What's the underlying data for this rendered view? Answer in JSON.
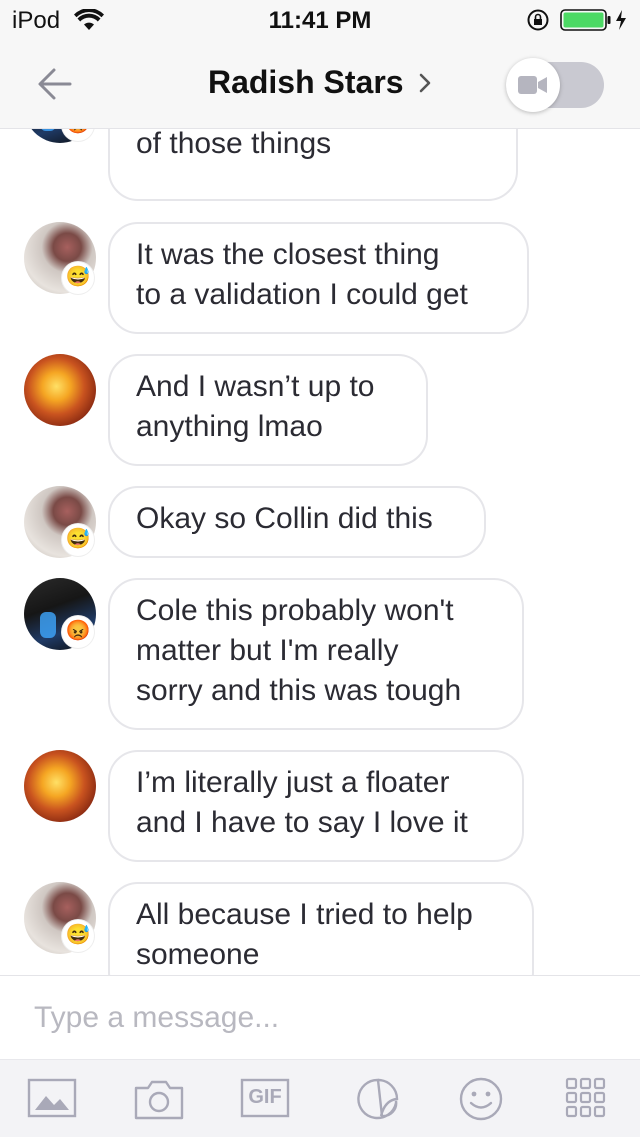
{
  "status_bar": {
    "carrier": "iPod",
    "time": "11:41 PM"
  },
  "header": {
    "title": "Radish Stars"
  },
  "messages": [
    {
      "text": "Umm and I didn't do any\nof those things",
      "emoji": "😡"
    },
    {
      "text": "It was the closest thing\nto a validation I could get",
      "emoji": "😅"
    },
    {
      "text": "And I wasn’t up to\nanything lmao",
      "emoji": ""
    },
    {
      "text": "Okay so Collin did this",
      "emoji": "😅"
    },
    {
      "text": "Cole this probably won't\nmatter but I'm really\nsorry and this was tough",
      "emoji": "😡"
    },
    {
      "text": "I’m literally just a floater\nand I have to say I love it",
      "emoji": ""
    },
    {
      "text": "All because I tried to help\nsomeone",
      "emoji": "😅"
    }
  ],
  "composer": {
    "placeholder": "Type a message..."
  },
  "toolbar": {
    "items": [
      "image-icon",
      "camera-icon",
      "gif-icon",
      "sticker-icon",
      "emoji-icon",
      "apps-grid-icon"
    ],
    "gif_label": "GIF"
  },
  "colors": {
    "battery_green": "#4cd964",
    "icon_gray": "#a9a9b8",
    "bubble_border": "#e6e6ea"
  }
}
